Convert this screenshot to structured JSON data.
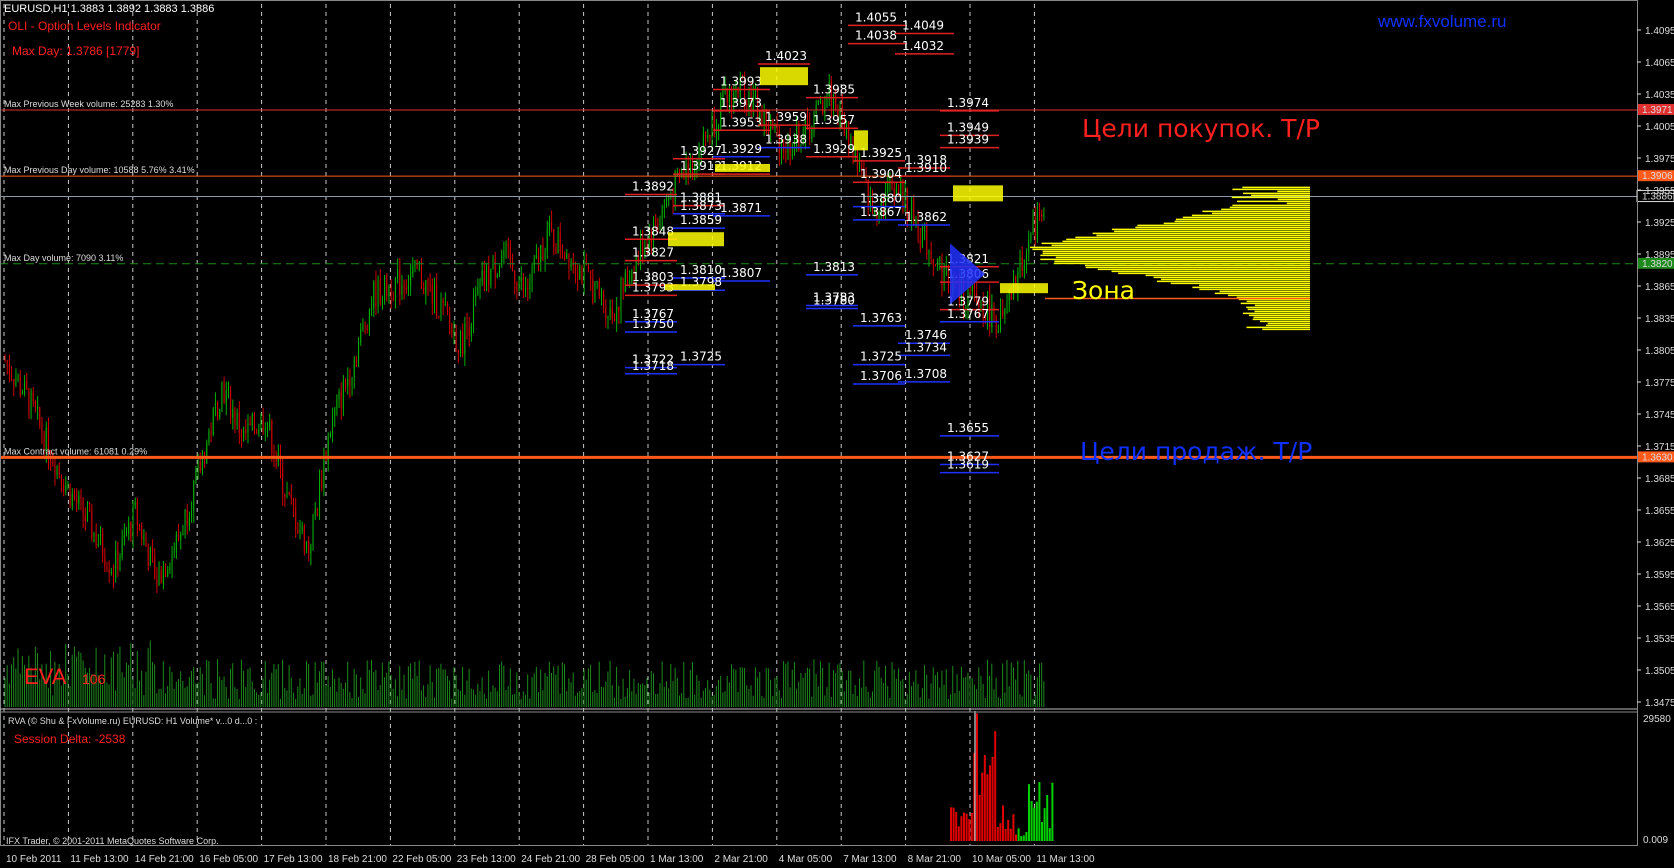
{
  "window": {
    "symbol_info": "EURUSD,H1  1.3883 1.3892 1.3883 1.3886",
    "indicator": "OLI - Option Levels Indicator",
    "max_day": "Max Day: 1.3786 [1779]",
    "site": "www.fxvolume.ru",
    "eva_label": "EVA",
    "eva_value": "106",
    "sub_title": "RVA (© Shu & FxVolume.ru) EURUSD: H1 Volume*  v...0 d...0 :",
    "session_delta": "Session Delta: -2538",
    "copyright": "IFX Trader, © 2001-2011 MetaQuotes Software Corp.",
    "buy_targets": "Цели покупок. T/P",
    "sell_targets": "Цели продаж. T/P",
    "zone": "Зона"
  },
  "colors": {
    "background": "#000000",
    "bull": "#00b000",
    "bear": "#d00000",
    "volume": "#1d8a1d",
    "profile": "#ffff00",
    "level_red": "#e02020",
    "level_blue": "#2030ff",
    "hline_orange": "#ff5a1a",
    "hline_red": "#e03030",
    "grid": "#c8c8c8"
  },
  "chart_data": {
    "type": "candlestick",
    "title": "EURUSD,H1",
    "ylim": [
      1.3385,
      1.4075
    ],
    "y_ticks": [
      "1.4095",
      "1.4065",
      "1.4035",
      "1.4005",
      "1.3975",
      "1.3955",
      "1.3925",
      "1.3895",
      "1.3865",
      "1.3835",
      "1.3805",
      "1.3775",
      "1.3745",
      "1.3715",
      "1.3685",
      "1.3655",
      "1.3625",
      "1.3595",
      "1.3565",
      "1.3535",
      "1.3505",
      "1.3475",
      "1.3445",
      "1.3415"
    ],
    "x_ticks": [
      "10 Feb 2011",
      "11 Feb 13:00",
      "14 Feb 21:00",
      "16 Feb 05:00",
      "17 Feb 13:00",
      "18 Feb 21:00",
      "22 Feb 05:00",
      "23 Feb 13:00",
      "24 Feb 21:00",
      "28 Feb 05:00",
      "1 Mar 13:00",
      "2 Mar 21:00",
      "4 Mar 05:00",
      "7 Mar 13:00",
      "8 Mar 21:00",
      "10 Mar 05:00",
      "11 Mar 13:00"
    ],
    "price_path": [
      [
        0,
        1.3725
      ],
      [
        1,
        1.369
      ],
      [
        2,
        1.364
      ],
      [
        3,
        1.3595
      ],
      [
        4,
        1.356
      ],
      [
        5,
        1.352
      ],
      [
        6,
        1.3575
      ],
      [
        7,
        1.351
      ],
      [
        8,
        1.355
      ],
      [
        9,
        1.362
      ],
      [
        10,
        1.37
      ],
      [
        11,
        1.365
      ],
      [
        12,
        1.367
      ],
      [
        13,
        1.359
      ],
      [
        14,
        1.354
      ],
      [
        15,
        1.366
      ],
      [
        16,
        1.372
      ],
      [
        17,
        1.379
      ],
      [
        18,
        1.38
      ],
      [
        19,
        1.381
      ],
      [
        20,
        1.378
      ],
      [
        21,
        1.374
      ],
      [
        22,
        1.38
      ],
      [
        23,
        1.383
      ],
      [
        24,
        1.379
      ],
      [
        25,
        1.385
      ],
      [
        26,
        1.383
      ],
      [
        27,
        1.38
      ],
      [
        28,
        1.377
      ],
      [
        29,
        1.382
      ],
      [
        30,
        1.386
      ],
      [
        31,
        1.39
      ],
      [
        32,
        1.393
      ],
      [
        33,
        1.3975
      ],
      [
        34,
        1.3995
      ],
      [
        35,
        1.396
      ],
      [
        36,
        1.3935
      ],
      [
        37,
        1.395
      ],
      [
        38,
        1.399
      ],
      [
        39,
        1.394
      ],
      [
        40,
        1.387
      ],
      [
        41,
        1.39
      ],
      [
        42,
        1.386
      ],
      [
        43,
        1.382
      ],
      [
        44,
        1.379
      ],
      [
        45,
        1.378
      ],
      [
        46,
        1.376
      ],
      [
        47,
        1.383
      ],
      [
        48,
        1.3886
      ]
    ],
    "h_lines": [
      {
        "label": "Max Previous Week volume: 25283 1.30%",
        "price": "1.3971",
        "tag": "1.3971",
        "color": "red",
        "thick": 1
      },
      {
        "label": "Max Previous Day volume: 10588 5.76% 3.41%",
        "price": "1.3906",
        "tag": "1.3906",
        "color": "orange",
        "thick": 1
      },
      {
        "label": "",
        "price": "1.3886",
        "tag": "1.3886",
        "color": "grey",
        "thick": 1
      },
      {
        "label": "Max Day volume: 7090 3.11%",
        "price": "1.3820",
        "tag": "1.3820",
        "color": "green-dash",
        "thick": 1
      },
      {
        "label": "Max Contract volume: 61081 0.29%",
        "price": "1.3630",
        "tag": "1.3630",
        "color": "orange",
        "thick": 3
      }
    ],
    "levels": [
      {
        "x": 855,
        "w": 52,
        "label": "1.4055",
        "price": 1.4058,
        "c": "red"
      },
      {
        "x": 855,
        "w": 52,
        "label": "1.4038",
        "price": 1.404,
        "c": "red"
      },
      {
        "x": 902,
        "w": 52,
        "label": "1.4049",
        "price": 1.405,
        "c": "red"
      },
      {
        "x": 902,
        "w": 52,
        "label": "1.4032",
        "price": 1.403,
        "c": "red"
      },
      {
        "x": 765,
        "w": 45,
        "label": "1.4023",
        "price": 1.402,
        "c": "red"
      },
      {
        "x": 720,
        "w": 50,
        "label": "1.3993",
        "price": 1.3995,
        "c": "red"
      },
      {
        "x": 813,
        "w": 45,
        "label": "1.3985",
        "price": 1.3987,
        "c": "red"
      },
      {
        "x": 720,
        "w": 50,
        "label": "1.3973",
        "price": 1.3974,
        "c": "red"
      },
      {
        "x": 947,
        "w": 52,
        "label": "1.3974",
        "price": 1.3974,
        "c": "red"
      },
      {
        "x": 720,
        "w": 50,
        "label": "1.3953",
        "price": 1.3955,
        "c": "red"
      },
      {
        "x": 765,
        "w": 45,
        "label": "1.3959",
        "price": 1.396,
        "c": "red"
      },
      {
        "x": 813,
        "w": 45,
        "label": "1.3957",
        "price": 1.3957,
        "c": "red"
      },
      {
        "x": 947,
        "w": 52,
        "label": "1.3949",
        "price": 1.395,
        "c": "red"
      },
      {
        "x": 947,
        "w": 52,
        "label": "1.3939",
        "price": 1.3938,
        "c": "red"
      },
      {
        "x": 765,
        "w": 45,
        "label": "1.3938",
        "price": 1.3938,
        "c": "blue"
      },
      {
        "x": 680,
        "w": 45,
        "label": "1.3927",
        "price": 1.3927,
        "c": "red"
      },
      {
        "x": 720,
        "w": 50,
        "label": "1.3929",
        "price": 1.3929,
        "c": "blue"
      },
      {
        "x": 813,
        "w": 45,
        "label": "1.3929",
        "price": 1.3929,
        "c": "red"
      },
      {
        "x": 860,
        "w": 45,
        "label": "1.3925",
        "price": 1.3925,
        "c": "red"
      },
      {
        "x": 905,
        "w": 45,
        "label": "1.3918",
        "price": 1.3918,
        "c": "red"
      },
      {
        "x": 905,
        "w": 45,
        "label": "1.3910",
        "price": 1.391,
        "c": "red"
      },
      {
        "x": 680,
        "w": 45,
        "label": "1.3912",
        "price": 1.3912,
        "c": "red"
      },
      {
        "x": 720,
        "w": 50,
        "label": "1.3912",
        "price": 1.3912,
        "c": "red"
      },
      {
        "x": 860,
        "w": 45,
        "label": "1.3904",
        "price": 1.3904,
        "c": "red"
      },
      {
        "x": 632,
        "w": 45,
        "label": "1.3892",
        "price": 1.3892,
        "c": "red"
      },
      {
        "x": 680,
        "w": 45,
        "label": "1.3881",
        "price": 1.3881,
        "c": "red"
      },
      {
        "x": 860,
        "w": 45,
        "label": "1.3880",
        "price": 1.388,
        "c": "blue"
      },
      {
        "x": 680,
        "w": 45,
        "label": "1.3873",
        "price": 1.3873,
        "c": "blue"
      },
      {
        "x": 720,
        "w": 50,
        "label": "1.3871",
        "price": 1.3871,
        "c": "blue"
      },
      {
        "x": 860,
        "w": 45,
        "label": "1.3867",
        "price": 1.3867,
        "c": "blue"
      },
      {
        "x": 905,
        "w": 45,
        "label": "1.3862",
        "price": 1.3862,
        "c": "blue"
      },
      {
        "x": 680,
        "w": 45,
        "label": "1.3859",
        "price": 1.3859,
        "c": "blue"
      },
      {
        "x": 632,
        "w": 45,
        "label": "1.3848",
        "price": 1.3848,
        "c": "red"
      },
      {
        "x": 632,
        "w": 45,
        "label": "1.3827",
        "price": 1.3827,
        "c": "red"
      },
      {
        "x": 947,
        "w": 52,
        "label": "1.3821",
        "price": 1.3821,
        "c": "red"
      },
      {
        "x": 813,
        "w": 45,
        "label": "1.3813",
        "price": 1.3813,
        "c": "blue"
      },
      {
        "x": 680,
        "w": 45,
        "label": "1.3810",
        "price": 1.381,
        "c": "blue"
      },
      {
        "x": 720,
        "w": 50,
        "label": "1.3807",
        "price": 1.3807,
        "c": "blue"
      },
      {
        "x": 947,
        "w": 52,
        "label": "1.3806",
        "price": 1.3806,
        "c": "red"
      },
      {
        "x": 632,
        "w": 45,
        "label": "1.3803",
        "price": 1.3803,
        "c": "red"
      },
      {
        "x": 680,
        "w": 45,
        "label": "1.3798",
        "price": 1.3798,
        "c": "blue"
      },
      {
        "x": 632,
        "w": 45,
        "label": "1.3793",
        "price": 1.3793,
        "c": "red"
      },
      {
        "x": 813,
        "w": 45,
        "label": "1.3783",
        "price": 1.3783,
        "c": "blue"
      },
      {
        "x": 813,
        "w": 45,
        "label": "1.3780",
        "price": 1.378,
        "c": "blue"
      },
      {
        "x": 947,
        "w": 52,
        "label": "1.3779",
        "price": 1.3779,
        "c": "red"
      },
      {
        "x": 632,
        "w": 45,
        "label": "1.3767",
        "price": 1.3767,
        "c": "blue"
      },
      {
        "x": 947,
        "w": 52,
        "label": "1.3767",
        "price": 1.3767,
        "c": "blue"
      },
      {
        "x": 860,
        "w": 45,
        "label": "1.3763",
        "price": 1.3763,
        "c": "blue"
      },
      {
        "x": 632,
        "w": 45,
        "label": "1.3750",
        "price": 1.3757,
        "c": "blue"
      },
      {
        "x": 905,
        "w": 45,
        "label": "1.3746",
        "price": 1.3746,
        "c": "blue"
      },
      {
        "x": 905,
        "w": 45,
        "label": "1.3734",
        "price": 1.3734,
        "c": "blue"
      },
      {
        "x": 680,
        "w": 45,
        "label": "1.3725",
        "price": 1.3725,
        "c": "blue"
      },
      {
        "x": 860,
        "w": 45,
        "label": "1.3725",
        "price": 1.3725,
        "c": "blue"
      },
      {
        "x": 632,
        "w": 45,
        "label": "1.3722",
        "price": 1.3722,
        "c": "blue"
      },
      {
        "x": 632,
        "w": 45,
        "label": "1.3718",
        "price": 1.3716,
        "c": "blue"
      },
      {
        "x": 860,
        "w": 45,
        "label": "1.3706",
        "price": 1.3706,
        "c": "blue"
      },
      {
        "x": 905,
        "w": 45,
        "label": "1.3708",
        "price": 1.3708,
        "c": "blue"
      },
      {
        "x": 947,
        "w": 52,
        "label": "1.3655",
        "price": 1.3655,
        "c": "blue"
      },
      {
        "x": 947,
        "w": 52,
        "label": "1.3627",
        "price": 1.3627,
        "c": "blue"
      },
      {
        "x": 947,
        "w": 52,
        "label": "1.3619",
        "price": 1.3619,
        "c": "blue"
      }
    ],
    "sub_axis": {
      "max_label": "29580",
      "min_label": "0.009"
    }
  }
}
